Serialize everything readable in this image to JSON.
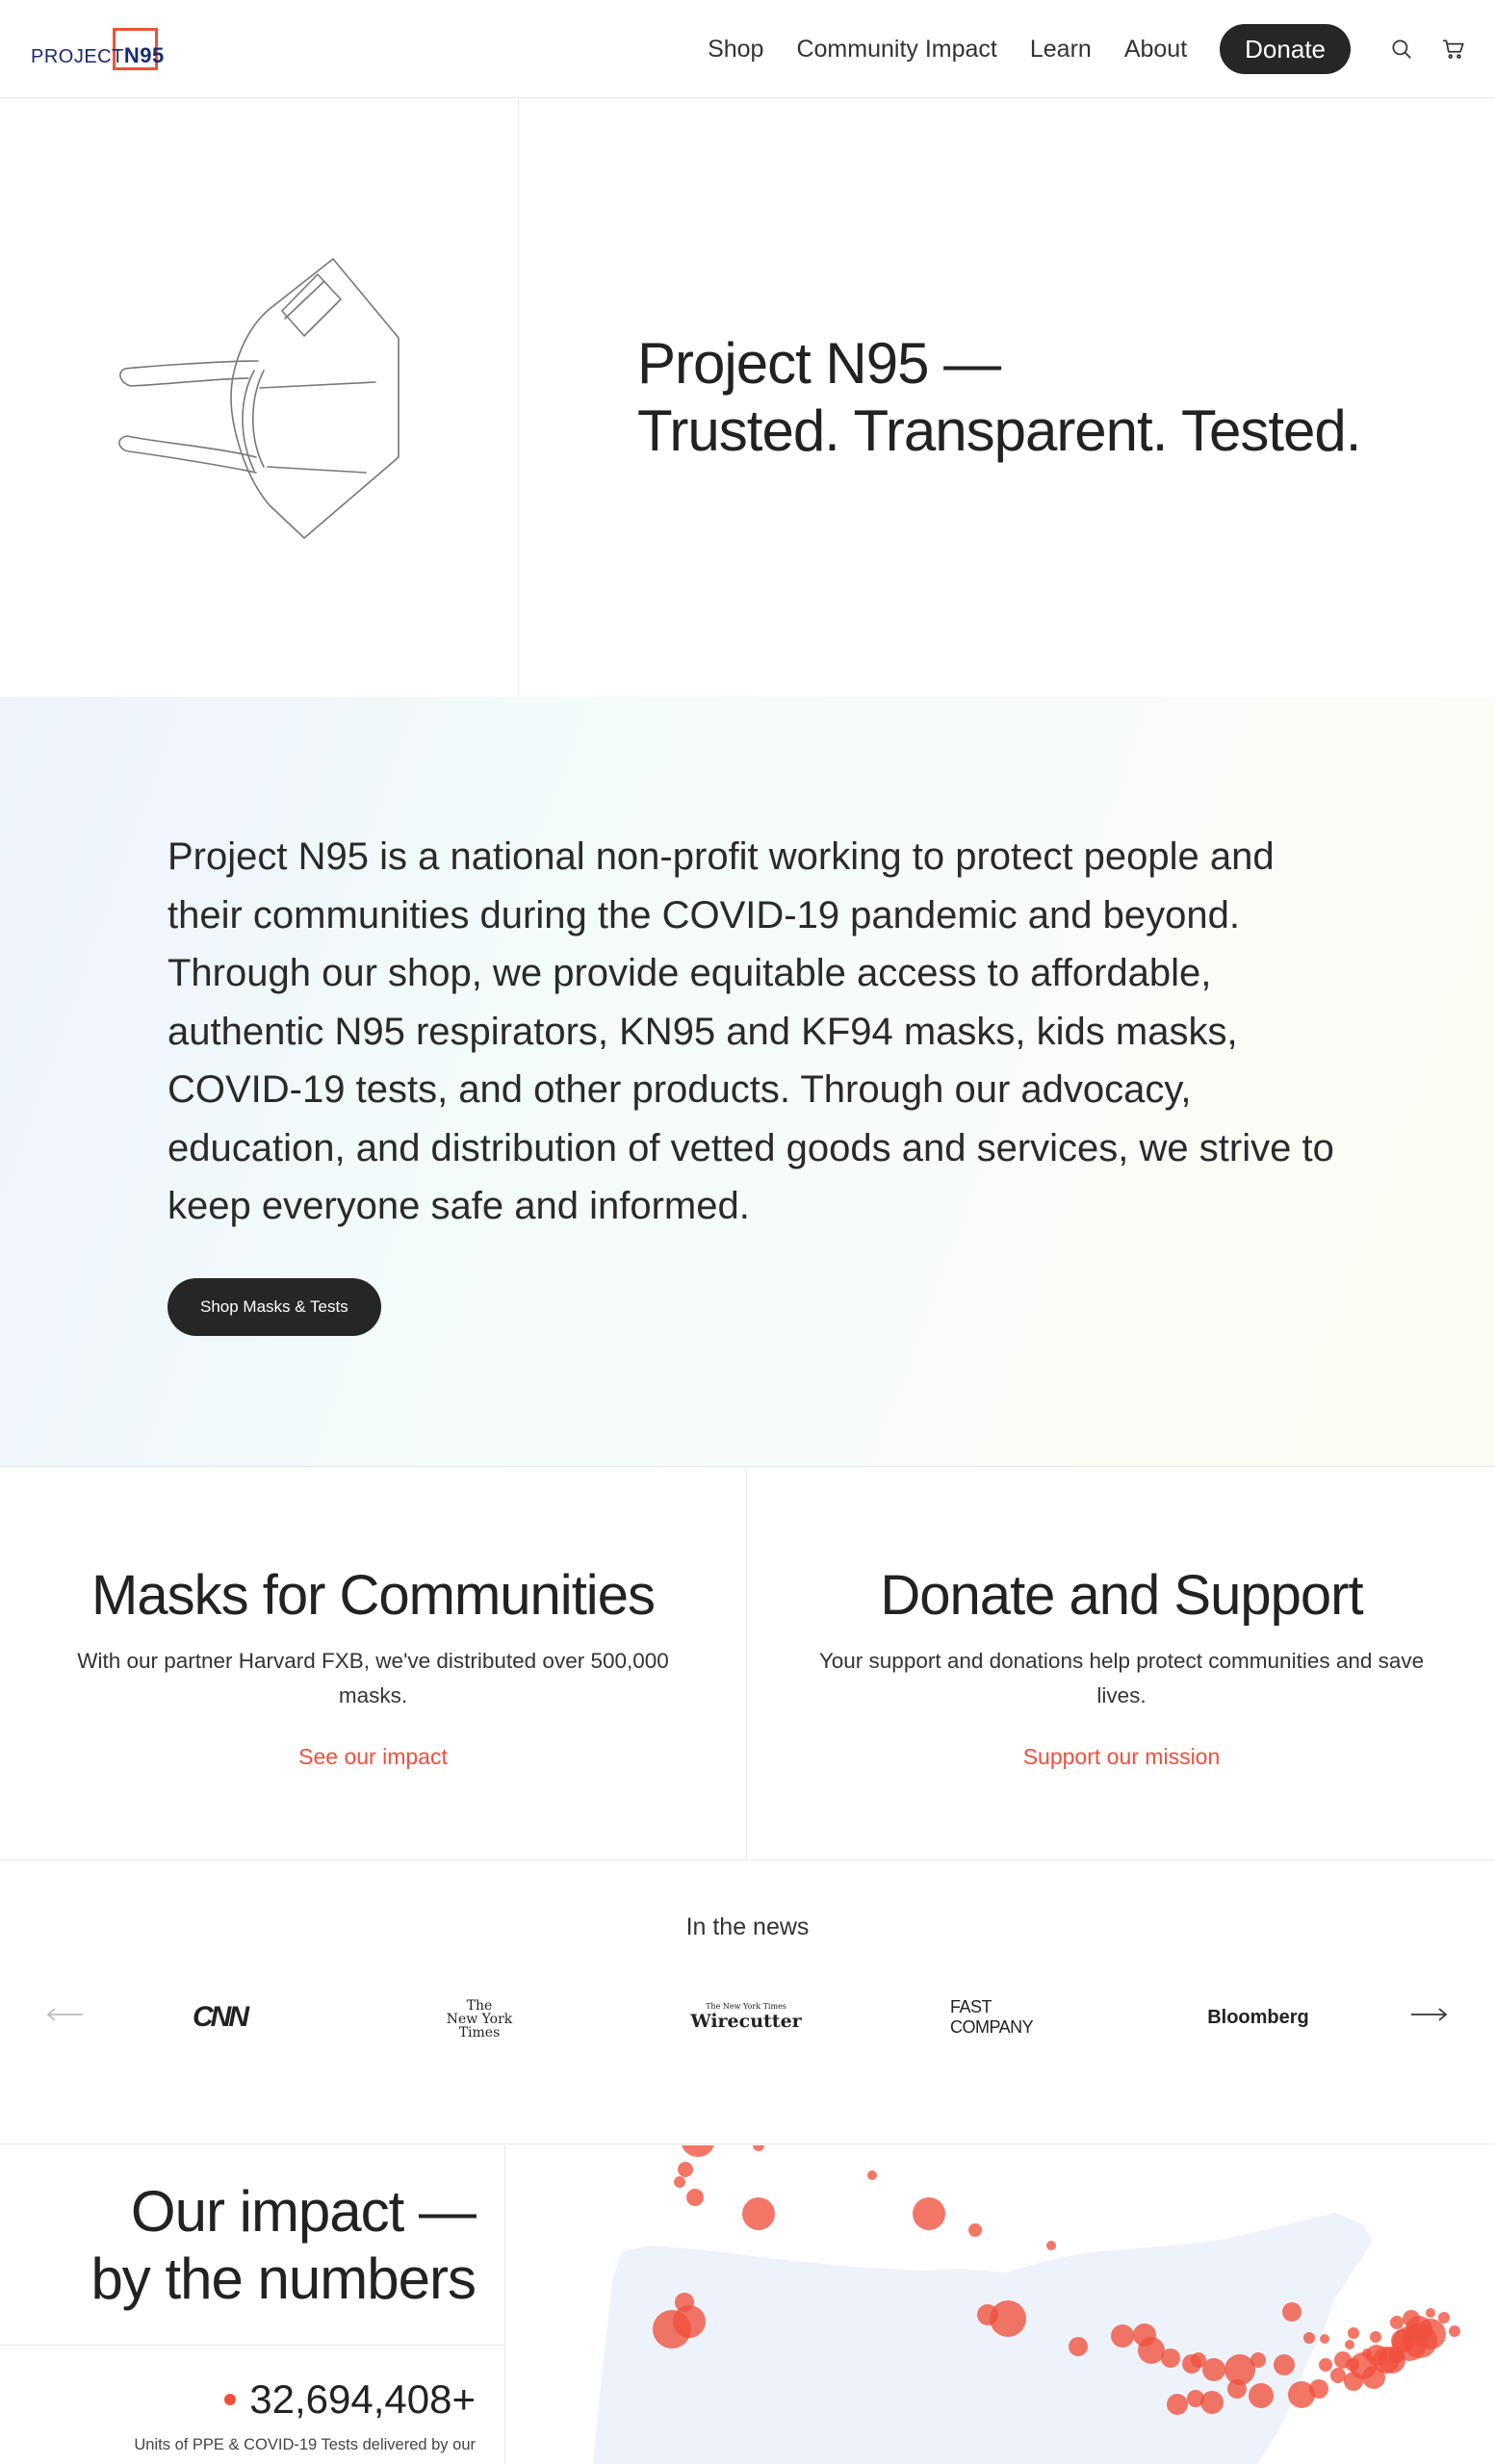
{
  "header": {
    "logo": {
      "prefix": "PROJECT",
      "suffix": "N95"
    },
    "nav": [
      "Shop",
      "Community Impact",
      "Learn",
      "About"
    ],
    "donate_label": "Donate",
    "icons": [
      "search-icon",
      "cart-icon"
    ]
  },
  "hero": {
    "title_line1": "Project N95 —",
    "title_line2": "Trusted. Transparent. Tested."
  },
  "mission": {
    "text": "Project N95 is a national non-profit working to protect people and their communities during the COVID-19 pandemic and beyond. Through our shop, we provide equitable access to affordable, authentic N95 respirators, KN95 and KF94 masks, kids masks, COVID-19 tests, and other products. Through our advocacy, education, and distribution of vetted goods and services, we strive to keep everyone safe and informed.",
    "button_label": "Shop Masks & Tests"
  },
  "cards": [
    {
      "title": "Masks for Communities",
      "body": "With our partner Harvard FXB, we've distributed over 500,000 masks.",
      "link": "See our impact"
    },
    {
      "title": "Donate and Support",
      "body": "Your support and donations help protect communities and save lives.",
      "link": "Support our mission"
    }
  ],
  "news": {
    "title": "In the news",
    "outlets": {
      "cnn": "CNN",
      "nyt": [
        "The",
        "New York",
        "Times"
      ],
      "wirecutter_small": "The New York Times",
      "wirecutter": "Wirecutter",
      "fastcompany": "FAST COMPANY",
      "bloomberg": "Bloomberg"
    }
  },
  "impact": {
    "title_line1": "Our impact —",
    "title_line2": "by the numbers",
    "stat_value": "32,694,408+",
    "stat_label": "Units of PPE & COVID-19 Tests delivered by our"
  },
  "colors": {
    "accent": "#f0503c",
    "dark_button": "#262626",
    "brand_navy": "#1a2a6c",
    "map_land": "#eef3fb"
  }
}
